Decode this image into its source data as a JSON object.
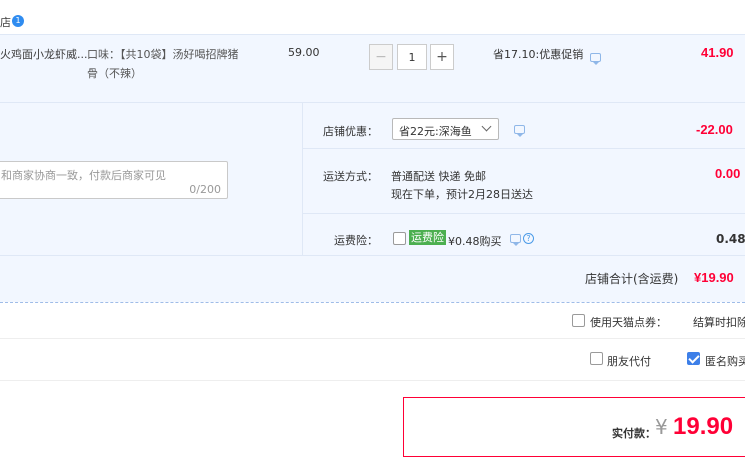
{
  "shop": {
    "name_tail": "店",
    "badge": "1"
  },
  "item": {
    "title": "火鸡面小龙虾威...",
    "spec_line1": "口味：【共10袋】汤好喝招牌猪",
    "spec_line2": "骨（不辣）",
    "unit_price": "59.00",
    "qty": "1",
    "qty_minus": "−",
    "qty_plus": "+",
    "discount": "省17.10:优惠促销",
    "subtotal": "41.90"
  },
  "message": {
    "placeholder": "和商家协商一致，付款后商家可见",
    "counter": "0/200"
  },
  "shop_coupon": {
    "label": "店铺优惠：",
    "selected": "省22元:深海鱼",
    "amount": "-22.00"
  },
  "shipping": {
    "label": "运送方式：",
    "line1": "普通配送 快递 免邮",
    "line2": "现在下单，预计2月28日送达",
    "amount": "0.00"
  },
  "insurance": {
    "label": "运费险：",
    "tag": "运费险",
    "price": "¥0.48购买",
    "amount": "0.48"
  },
  "shop_total": {
    "label": "店铺合计(含运费)",
    "amount": "¥19.90"
  },
  "points": {
    "label": "使用天猫点券：",
    "note": "结算时扣除"
  },
  "options": {
    "friend_pay": "朋友代付",
    "anonymous": "匿名购买"
  },
  "pay": {
    "label": "实付款：",
    "currency": "¥",
    "amount": "19.90"
  },
  "colors": {
    "accent_red": "#ff0036",
    "blue_bg": "#f2f7ff",
    "tag_green": "#4caf50",
    "check_blue": "#3d7fe8"
  }
}
